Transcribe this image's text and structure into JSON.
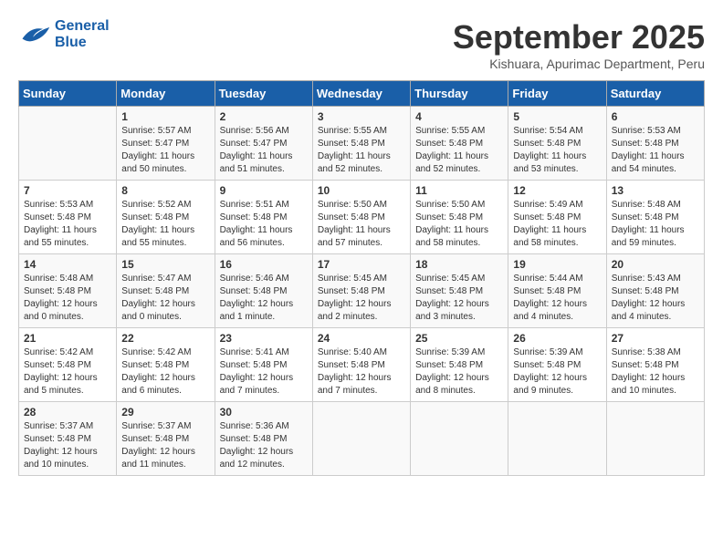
{
  "header": {
    "logo_line1": "General",
    "logo_line2": "Blue",
    "month_title": "September 2025",
    "location": "Kishuara, Apurimac Department, Peru"
  },
  "days_of_week": [
    "Sunday",
    "Monday",
    "Tuesday",
    "Wednesday",
    "Thursday",
    "Friday",
    "Saturday"
  ],
  "weeks": [
    [
      {
        "day": "",
        "info": ""
      },
      {
        "day": "1",
        "info": "Sunrise: 5:57 AM\nSunset: 5:47 PM\nDaylight: 11 hours\nand 50 minutes."
      },
      {
        "day": "2",
        "info": "Sunrise: 5:56 AM\nSunset: 5:47 PM\nDaylight: 11 hours\nand 51 minutes."
      },
      {
        "day": "3",
        "info": "Sunrise: 5:55 AM\nSunset: 5:48 PM\nDaylight: 11 hours\nand 52 minutes."
      },
      {
        "day": "4",
        "info": "Sunrise: 5:55 AM\nSunset: 5:48 PM\nDaylight: 11 hours\nand 52 minutes."
      },
      {
        "day": "5",
        "info": "Sunrise: 5:54 AM\nSunset: 5:48 PM\nDaylight: 11 hours\nand 53 minutes."
      },
      {
        "day": "6",
        "info": "Sunrise: 5:53 AM\nSunset: 5:48 PM\nDaylight: 11 hours\nand 54 minutes."
      }
    ],
    [
      {
        "day": "7",
        "info": "Sunrise: 5:53 AM\nSunset: 5:48 PM\nDaylight: 11 hours\nand 55 minutes."
      },
      {
        "day": "8",
        "info": "Sunrise: 5:52 AM\nSunset: 5:48 PM\nDaylight: 11 hours\nand 55 minutes."
      },
      {
        "day": "9",
        "info": "Sunrise: 5:51 AM\nSunset: 5:48 PM\nDaylight: 11 hours\nand 56 minutes."
      },
      {
        "day": "10",
        "info": "Sunrise: 5:50 AM\nSunset: 5:48 PM\nDaylight: 11 hours\nand 57 minutes."
      },
      {
        "day": "11",
        "info": "Sunrise: 5:50 AM\nSunset: 5:48 PM\nDaylight: 11 hours\nand 58 minutes."
      },
      {
        "day": "12",
        "info": "Sunrise: 5:49 AM\nSunset: 5:48 PM\nDaylight: 11 hours\nand 58 minutes."
      },
      {
        "day": "13",
        "info": "Sunrise: 5:48 AM\nSunset: 5:48 PM\nDaylight: 11 hours\nand 59 minutes."
      }
    ],
    [
      {
        "day": "14",
        "info": "Sunrise: 5:48 AM\nSunset: 5:48 PM\nDaylight: 12 hours\nand 0 minutes."
      },
      {
        "day": "15",
        "info": "Sunrise: 5:47 AM\nSunset: 5:48 PM\nDaylight: 12 hours\nand 0 minutes."
      },
      {
        "day": "16",
        "info": "Sunrise: 5:46 AM\nSunset: 5:48 PM\nDaylight: 12 hours\nand 1 minute."
      },
      {
        "day": "17",
        "info": "Sunrise: 5:45 AM\nSunset: 5:48 PM\nDaylight: 12 hours\nand 2 minutes."
      },
      {
        "day": "18",
        "info": "Sunrise: 5:45 AM\nSunset: 5:48 PM\nDaylight: 12 hours\nand 3 minutes."
      },
      {
        "day": "19",
        "info": "Sunrise: 5:44 AM\nSunset: 5:48 PM\nDaylight: 12 hours\nand 4 minutes."
      },
      {
        "day": "20",
        "info": "Sunrise: 5:43 AM\nSunset: 5:48 PM\nDaylight: 12 hours\nand 4 minutes."
      }
    ],
    [
      {
        "day": "21",
        "info": "Sunrise: 5:42 AM\nSunset: 5:48 PM\nDaylight: 12 hours\nand 5 minutes."
      },
      {
        "day": "22",
        "info": "Sunrise: 5:42 AM\nSunset: 5:48 PM\nDaylight: 12 hours\nand 6 minutes."
      },
      {
        "day": "23",
        "info": "Sunrise: 5:41 AM\nSunset: 5:48 PM\nDaylight: 12 hours\nand 7 minutes."
      },
      {
        "day": "24",
        "info": "Sunrise: 5:40 AM\nSunset: 5:48 PM\nDaylight: 12 hours\nand 7 minutes."
      },
      {
        "day": "25",
        "info": "Sunrise: 5:39 AM\nSunset: 5:48 PM\nDaylight: 12 hours\nand 8 minutes."
      },
      {
        "day": "26",
        "info": "Sunrise: 5:39 AM\nSunset: 5:48 PM\nDaylight: 12 hours\nand 9 minutes."
      },
      {
        "day": "27",
        "info": "Sunrise: 5:38 AM\nSunset: 5:48 PM\nDaylight: 12 hours\nand 10 minutes."
      }
    ],
    [
      {
        "day": "28",
        "info": "Sunrise: 5:37 AM\nSunset: 5:48 PM\nDaylight: 12 hours\nand 10 minutes."
      },
      {
        "day": "29",
        "info": "Sunrise: 5:37 AM\nSunset: 5:48 PM\nDaylight: 12 hours\nand 11 minutes."
      },
      {
        "day": "30",
        "info": "Sunrise: 5:36 AM\nSunset: 5:48 PM\nDaylight: 12 hours\nand 12 minutes."
      },
      {
        "day": "",
        "info": ""
      },
      {
        "day": "",
        "info": ""
      },
      {
        "day": "",
        "info": ""
      },
      {
        "day": "",
        "info": ""
      }
    ]
  ]
}
